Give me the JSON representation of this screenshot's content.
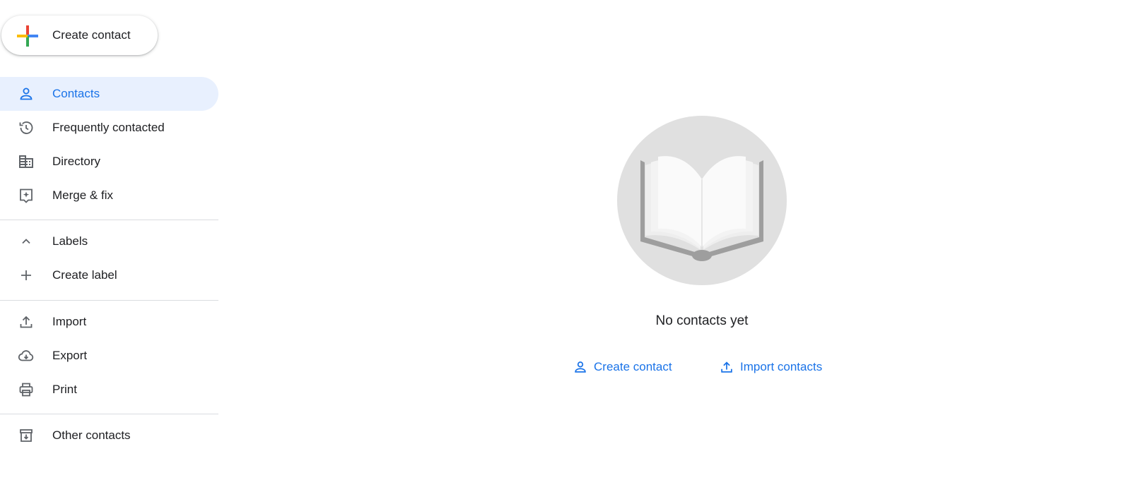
{
  "sidebar": {
    "create_button": {
      "label": "Create contact",
      "icon": "plus-multicolor-icon"
    },
    "items": [
      {
        "label": "Contacts",
        "icon": "person-icon",
        "active": true
      },
      {
        "label": "Frequently contacted",
        "icon": "history-icon"
      },
      {
        "label": "Directory",
        "icon": "domain-icon"
      },
      {
        "label": "Merge & fix",
        "icon": "auto-fix-icon"
      }
    ],
    "labels_section": {
      "header": {
        "label": "Labels",
        "icon": "chevron-up-icon"
      },
      "create": {
        "label": "Create label",
        "icon": "plus-icon"
      }
    },
    "tools": [
      {
        "label": "Import",
        "icon": "upload-icon"
      },
      {
        "label": "Export",
        "icon": "cloud-download-icon"
      },
      {
        "label": "Print",
        "icon": "printer-icon"
      }
    ],
    "other": {
      "label": "Other contacts",
      "icon": "archive-icon"
    }
  },
  "main": {
    "empty_state": {
      "illustration": "open-book-illustration",
      "message": "No contacts yet"
    },
    "actions": [
      {
        "label": "Create contact",
        "icon": "person-add-icon"
      },
      {
        "label": "Import contacts",
        "icon": "upload-icon"
      }
    ]
  },
  "colors": {
    "accent": "#1a73e8",
    "active_bg": "#e8f0fe",
    "icon_gray": "#5f6368",
    "divider": "#dadce0",
    "plus_red": "#ea4335",
    "plus_blue": "#4285f4",
    "plus_yellow": "#fbbc04",
    "plus_green": "#34a853"
  }
}
